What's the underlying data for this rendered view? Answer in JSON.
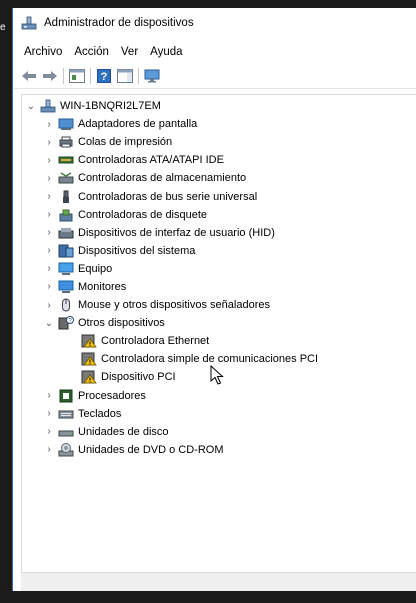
{
  "edge": {
    "text": "e"
  },
  "window": {
    "title": "Administrador de dispositivos"
  },
  "menu": [
    {
      "label": "Archivo"
    },
    {
      "label": "Acción"
    },
    {
      "label": "Ver"
    },
    {
      "label": "Ayuda"
    }
  ],
  "tree": {
    "root": "WIN-1BNQRI2L7EM",
    "categories": [
      {
        "label": "Adaptadores de pantalla",
        "icon": "display-adapter-icon"
      },
      {
        "label": "Colas de impresión",
        "icon": "print-queue-icon"
      },
      {
        "label": "Controladoras ATA/ATAPI IDE",
        "icon": "ide-controller-icon"
      },
      {
        "label": "Controladoras de almacenamiento",
        "icon": "storage-controller-icon"
      },
      {
        "label": "Controladoras de bus serie universal",
        "icon": "usb-icon"
      },
      {
        "label": "Controladoras de disquete",
        "icon": "floppy-controller-icon"
      },
      {
        "label": "Dispositivos de interfaz de usuario (HID)",
        "icon": "hid-icon"
      },
      {
        "label": "Dispositivos del sistema",
        "icon": "system-devices-icon"
      },
      {
        "label": "Equipo",
        "icon": "computer-icon"
      },
      {
        "label": "Monitores",
        "icon": "monitor-icon"
      },
      {
        "label": "Mouse y otros dispositivos señaladores",
        "icon": "mouse-icon"
      },
      {
        "label": "Otros dispositivos",
        "icon": "other-devices-icon"
      },
      {
        "label": "Procesadores",
        "icon": "processor-icon"
      },
      {
        "label": "Teclados",
        "icon": "keyboard-icon"
      },
      {
        "label": "Unidades de disco",
        "icon": "disk-drive-icon"
      },
      {
        "label": "Unidades de DVD o CD-ROM",
        "icon": "dvd-drive-icon"
      }
    ],
    "other_devices": [
      {
        "label": "Controladora Ethernet",
        "icon": "unknown-device-warning-icon"
      },
      {
        "label": "Controladora simple de comunicaciones PCI",
        "icon": "unknown-device-warning-icon"
      },
      {
        "label": "Dispositivo PCI",
        "icon": "unknown-device-warning-icon"
      }
    ]
  },
  "colors": {
    "accent": "#3a6ea5",
    "warning": "#f2c200",
    "desktop": "#1b1b1b"
  }
}
